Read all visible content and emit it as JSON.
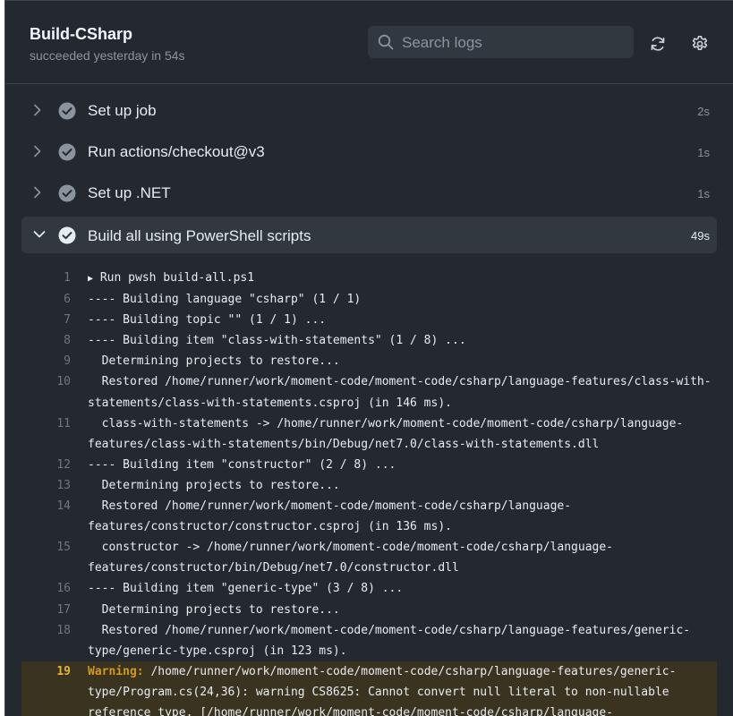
{
  "header": {
    "title": "Build-CSharp",
    "subtitle": "succeeded yesterday in 54s",
    "search_placeholder": "Search logs"
  },
  "steps": [
    {
      "label": "Set up job",
      "duration": "2s"
    },
    {
      "label": "Run actions/checkout@v3",
      "duration": "1s"
    },
    {
      "label": "Set up .NET",
      "duration": "1s"
    },
    {
      "label": "Build all using PowerShell scripts",
      "duration": "49s"
    }
  ],
  "log": {
    "first_line": {
      "num": "1",
      "toggle": "▶",
      "text": "Run pwsh build-all.ps1"
    },
    "lines": [
      {
        "num": "6",
        "text": "---- Building language \"csharp\" (1 / 1)"
      },
      {
        "num": "7",
        "text": "---- Building topic \"\" (1 / 1) ..."
      },
      {
        "num": "8",
        "text": "---- Building item \"class-with-statements\" (1 / 8) ..."
      },
      {
        "num": "9",
        "text": "  Determining projects to restore..."
      },
      {
        "num": "10",
        "text": "  Restored /home/runner/work/moment-code/moment-code/csharp/language-features/class-with-statements/class-with-statements.csproj (in 146 ms)."
      },
      {
        "num": "11",
        "text": "  class-with-statements -> /home/runner/work/moment-code/moment-code/csharp/language-features/class-with-statements/bin/Debug/net7.0/class-with-statements.dll"
      },
      {
        "num": "12",
        "text": "---- Building item \"constructor\" (2 / 8) ..."
      },
      {
        "num": "13",
        "text": "  Determining projects to restore..."
      },
      {
        "num": "14",
        "text": "  Restored /home/runner/work/moment-code/moment-code/csharp/language-features/constructor/constructor.csproj (in 136 ms)."
      },
      {
        "num": "15",
        "text": "  constructor -> /home/runner/work/moment-code/moment-code/csharp/language-features/constructor/bin/Debug/net7.0/constructor.dll"
      },
      {
        "num": "16",
        "text": "---- Building item \"generic-type\" (3 / 8) ..."
      },
      {
        "num": "17",
        "text": "  Determining projects to restore..."
      },
      {
        "num": "18",
        "text": "  Restored /home/runner/work/moment-code/moment-code/csharp/language-features/generic-type/generic-type.csproj (in 123 ms)."
      }
    ],
    "warning": {
      "num": "19",
      "label": "Warning:",
      "text": " /home/runner/work/moment-code/moment-code/csharp/language-features/generic-type/Program.cs(24,36): warning CS8625: Cannot convert null literal to non-nullable reference type. [/home/runner/work/moment-code/moment-code/csharp/language-features/generic-"
    }
  },
  "colors": {
    "background": "#24292f",
    "success_check": "#8b949e",
    "warning": "#d29922"
  },
  "icons": [
    "search-icon",
    "refresh-icon",
    "gear-icon",
    "chevron-right-icon",
    "chevron-down-icon",
    "check-circle-icon"
  ]
}
